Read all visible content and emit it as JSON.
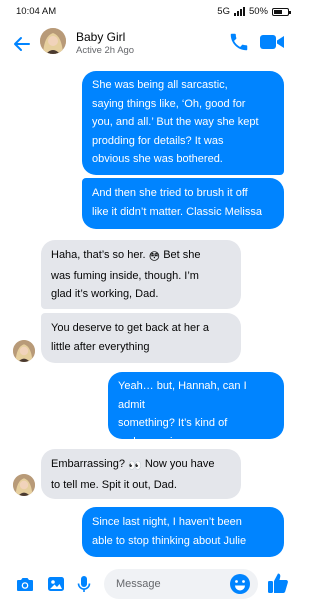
{
  "status_bar": {
    "time": "10:04 AM",
    "network": "5G",
    "battery": "50%"
  },
  "header": {
    "contact_name": "Baby Girl",
    "contact_status": "Active 2h Ago",
    "icons": {
      "back": "back-arrow-icon",
      "call": "phone-icon",
      "video": "video-camera-icon"
    }
  },
  "messages": [
    {
      "sender": "me",
      "lines": [
        "She was being all sarcastic,",
        "saying things like, ‘Oh, good for",
        "you, and all.’ But the way she kept",
        "prodding for details? It was",
        "obvious she was bothered."
      ]
    },
    {
      "sender": "me",
      "lines": [
        "And then she tried to brush it off",
        "like it didn’t matter. Classic Melissa"
      ]
    },
    {
      "sender": "them",
      "lines": [
        "Haha, that’s so her.",
        "Bet she",
        "was fuming inside, though. I’m",
        "glad it’s working, Dad."
      ],
      "emoji": "😳"
    },
    {
      "sender": "them",
      "lines": [
        "You deserve to get back at her a",
        "little after everything"
      ]
    },
    {
      "sender": "me",
      "lines": [
        "Yeah… but, Hannah, can I admit",
        "something? It’s kind of",
        "embarrassing"
      ]
    },
    {
      "sender": "them",
      "lines": [
        "Embarrassing?",
        "Now you have",
        "to tell me. Spit it out, Dad."
      ],
      "emoji": "👀"
    },
    {
      "sender": "me",
      "lines": [
        "Since last night, I haven’t been",
        "able to stop thinking about Julie"
      ]
    }
  ],
  "composer": {
    "placeholder": "Message",
    "icons": {
      "camera": "camera-icon",
      "gallery": "gallery-icon",
      "mic": "microphone-icon",
      "emoji": "smiley-icon",
      "like": "thumbs-up-icon"
    }
  },
  "colors": {
    "accent": "#0084ff",
    "incoming_bubble": "#e4e6eb",
    "secondary_text": "#65676b"
  }
}
